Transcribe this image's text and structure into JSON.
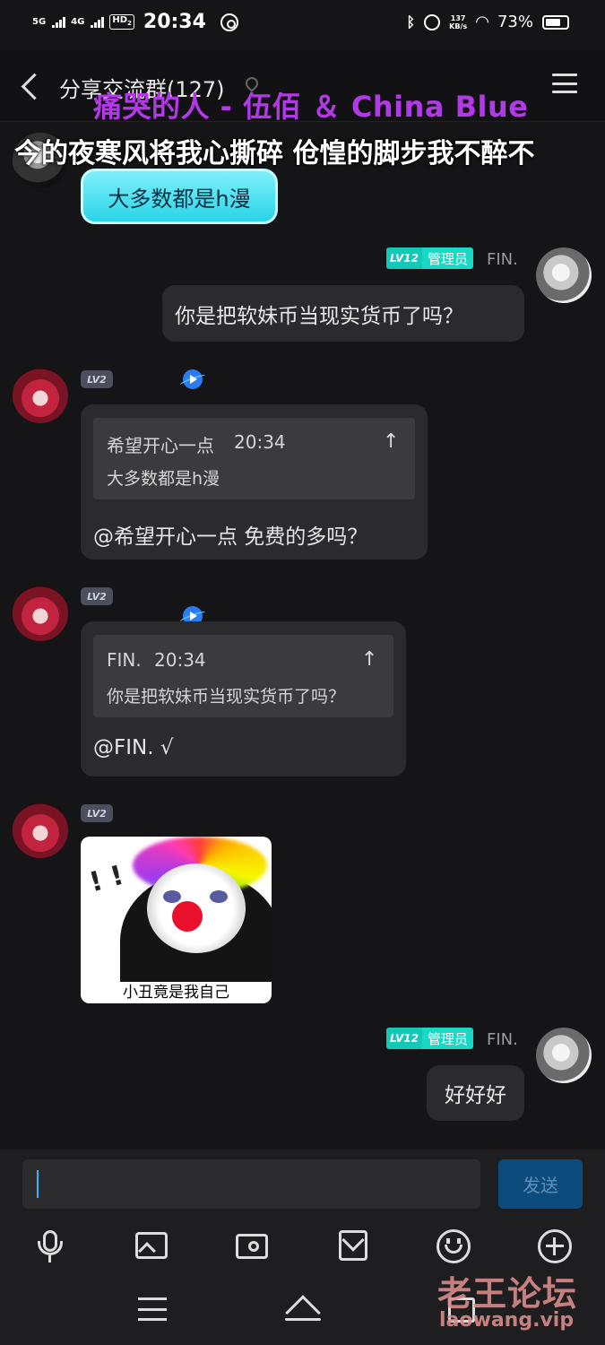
{
  "status_bar": {
    "sim1": "5G",
    "sim2": "4G",
    "hd": "HD",
    "hd_sub": "2",
    "time": "20:34",
    "net_speed_value": "137",
    "net_speed_unit": "KB/s",
    "battery": "73%",
    "battery_level": 0.73
  },
  "header": {
    "title": "分享交流群(127)"
  },
  "lyrics": {
    "song": "痛哭的人 - 伍佰 ＆ China Blue",
    "line": "今的夜寒风将我心撕碎  伧惶的脚步我不醉不"
  },
  "messages": [
    {
      "side": "left",
      "text": "大多数都是h漫",
      "style": "cyan-bubble"
    },
    {
      "side": "right",
      "level": "LV12",
      "role": "管理员",
      "name": "FIN.",
      "text": "你是把软妹币当现实货币了吗？"
    },
    {
      "side": "left",
      "level": "LV2",
      "quote": {
        "author": "希望开心一点",
        "time": "20:34",
        "text": "大多数都是h漫"
      },
      "text": "@希望开心一点  免费的多吗？"
    },
    {
      "side": "left",
      "level": "LV2",
      "quote": {
        "author": "FIN.",
        "time": "20:34",
        "text": "你是把软妹币当现实货币了吗？"
      },
      "text": "@FIN.  √"
    },
    {
      "side": "left",
      "level": "LV2",
      "sticker_caption": "小丑竟是我自己"
    },
    {
      "side": "right",
      "level": "LV12",
      "role": "管理员",
      "name": "FIN.",
      "text": "好好好"
    }
  ],
  "composer": {
    "input_value": "",
    "send_label": "发送"
  },
  "toolbar": {
    "icons": [
      "microphone-icon",
      "image-icon",
      "camera-icon",
      "red-packet-icon",
      "emoji-icon",
      "plus-icon"
    ]
  },
  "watermark": {
    "cn": "老王论坛",
    "url": "laowang.vip"
  },
  "colors": {
    "background": "#151517",
    "accent_cyan": "#2ad4e8",
    "admin_badge": "#18d9c6",
    "lyric_purple": "#b23ae6",
    "send_button": "#0b4b7d"
  }
}
